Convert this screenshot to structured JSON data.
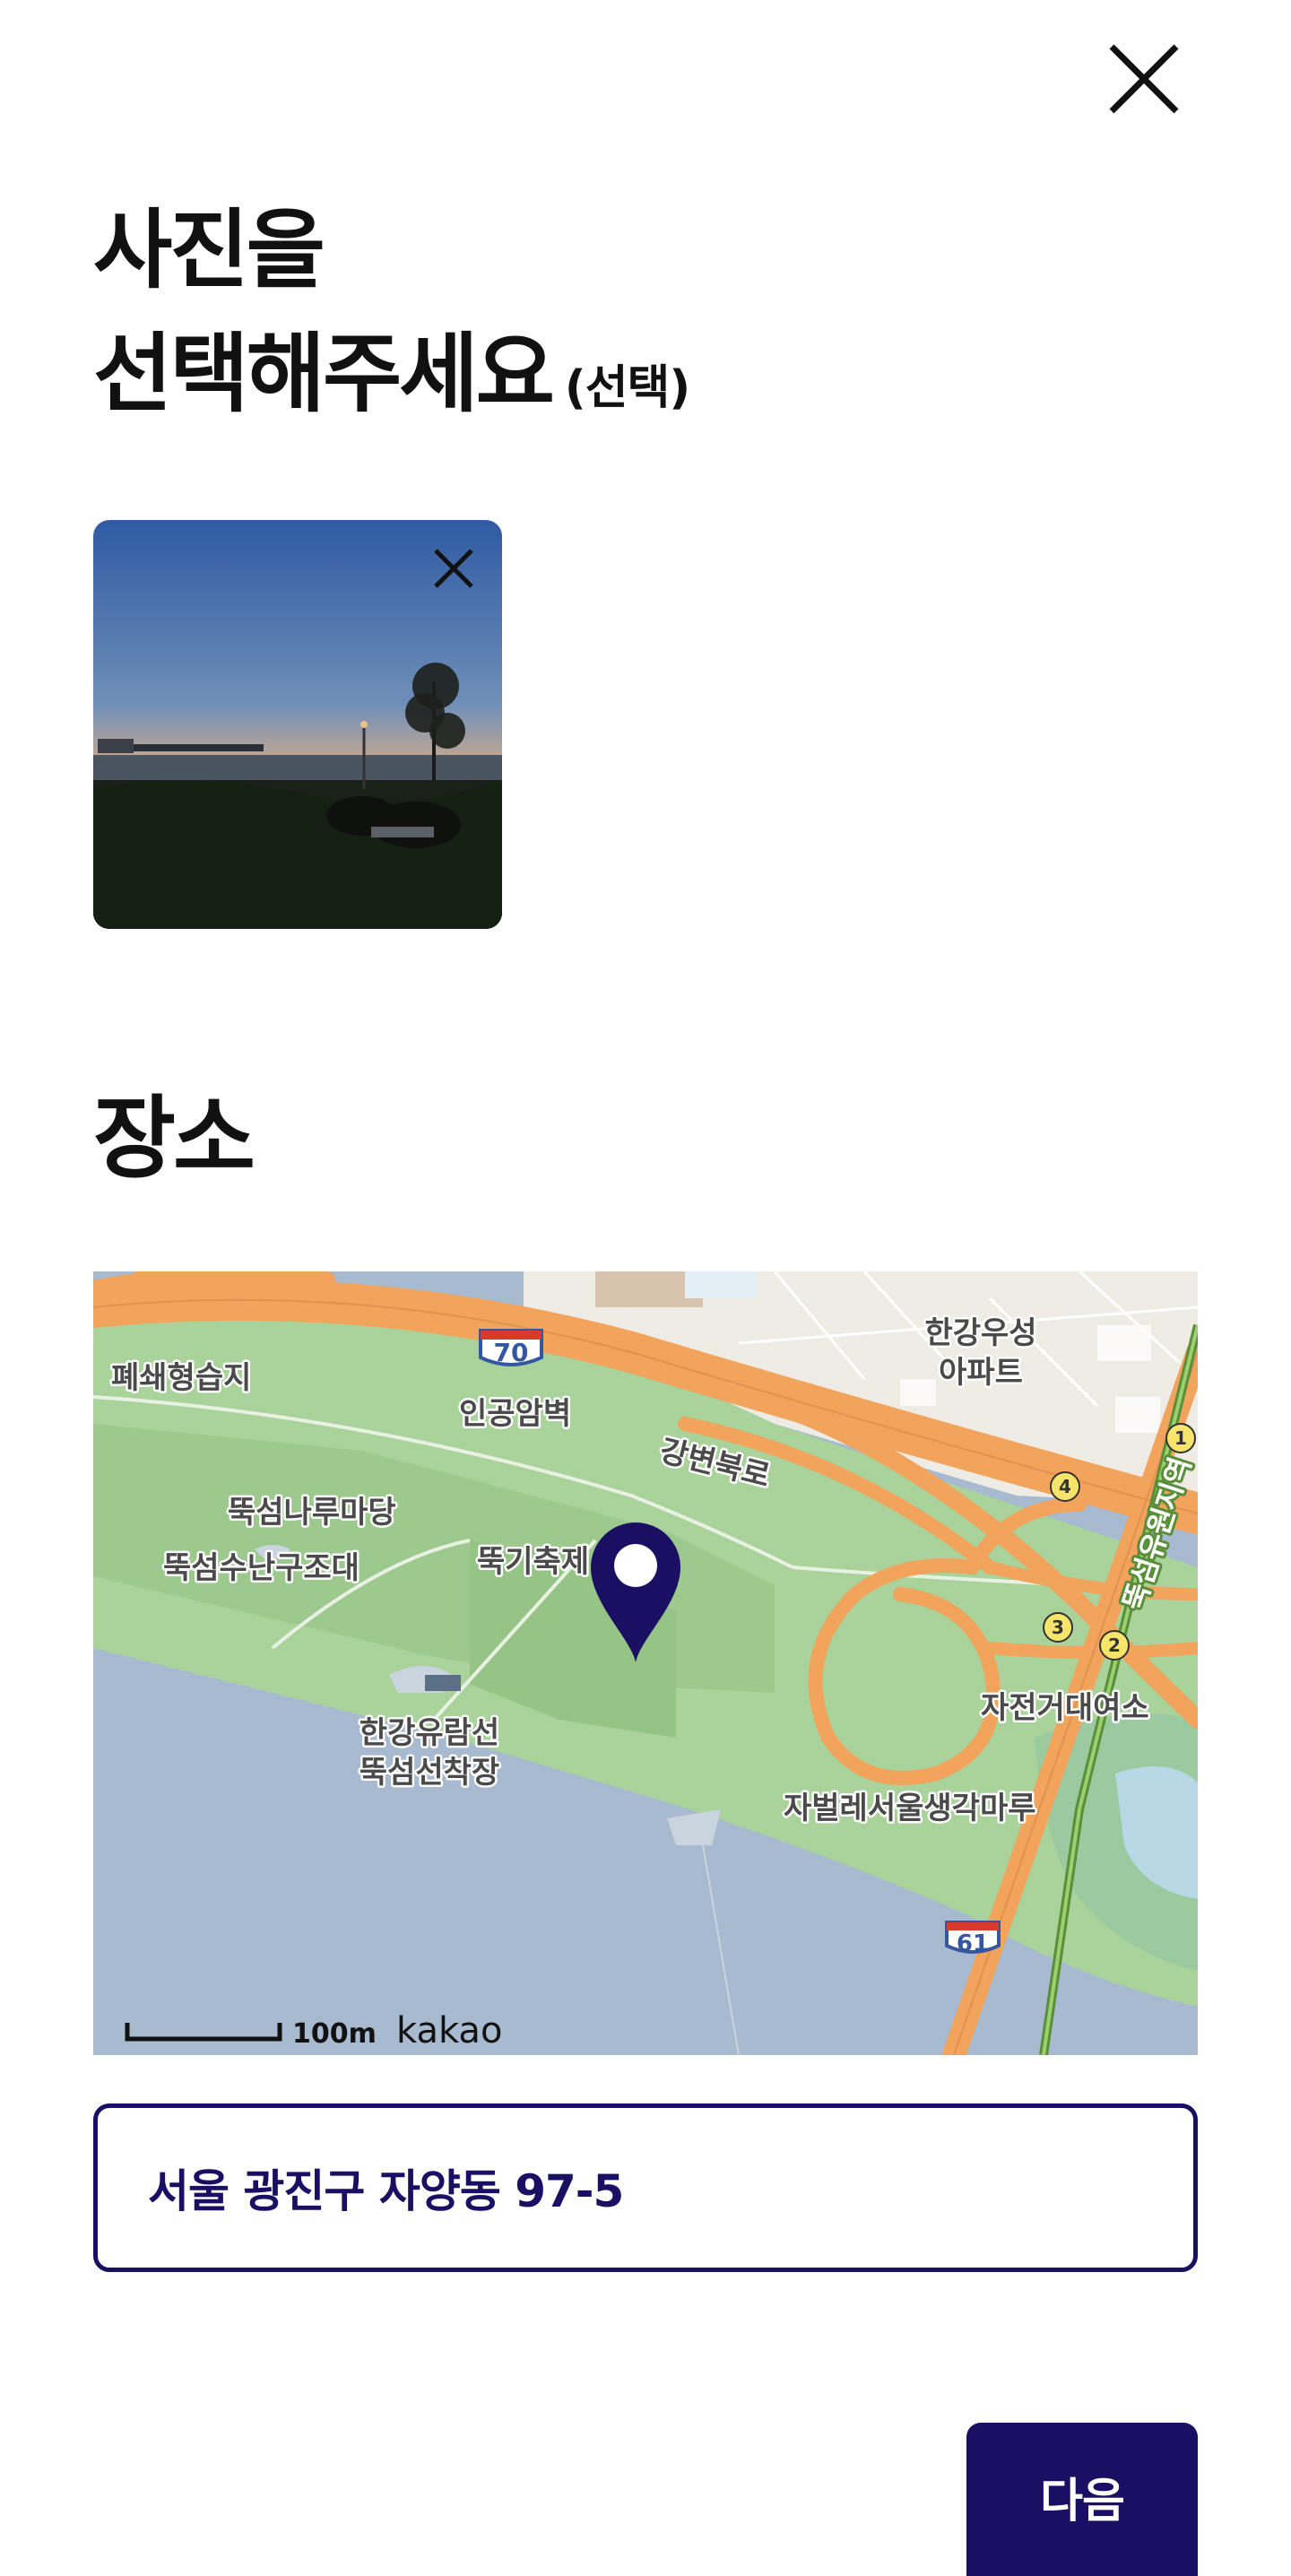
{
  "header": {
    "close_icon": "close-icon"
  },
  "photo_section": {
    "title_line1": "사진을",
    "title_line2": "선택해주세요",
    "optional_label": "(선택)",
    "thumbnail_remove_icon": "close-icon"
  },
  "place_section": {
    "title": "장소",
    "map": {
      "labels": {
        "wetland": "폐쇄형습지",
        "artificial_rock": "인공암벽",
        "gangbyeon_road": "강변북로",
        "apartment_line1": "한강우성",
        "apartment_line2": "아파트",
        "naru_madang": "뚝섬나루마당",
        "water_fountain": "뚝섬수난구조대",
        "festival": "뚝기축제",
        "ferry_line1": "한강유람선",
        "ferry_line2": "뚝섬선착장",
        "bike_rental": "자전거대여소",
        "jabeolle": "자벌레서울생각마루",
        "station": "뚝섬유원지역"
      },
      "road_shield_north": "70",
      "road_shield_south": "61",
      "exits": [
        "1",
        "2",
        "3",
        "4"
      ],
      "scale_label": "100m",
      "provider_logo": "kakao",
      "pin_icon": "map-pin-icon"
    },
    "address": "서울 광진구 자양동 97-5"
  },
  "footer": {
    "next_label": "다음"
  },
  "colors": {
    "primary": "#1a0f63",
    "map_water": "#a7bad0",
    "map_park": "#a9d39b",
    "map_road": "#f2a35c"
  }
}
